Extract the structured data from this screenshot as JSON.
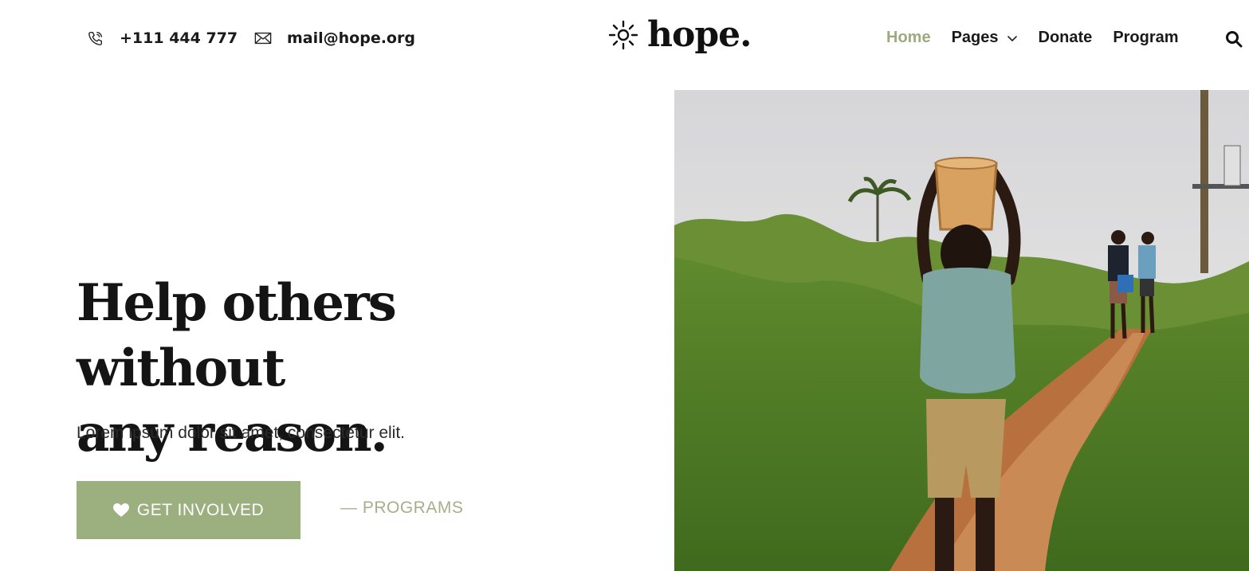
{
  "header": {
    "phone": "+111 444 777",
    "email": "mail@hope.org",
    "logo_text": "hope.",
    "icons": {
      "phone": "phone-icon",
      "mail": "mail-icon",
      "logo": "sun-icon",
      "search": "search-icon",
      "chevron": "chevron-down-icon"
    }
  },
  "nav": {
    "items": [
      {
        "label": "Home",
        "active": true
      },
      {
        "label": "Pages",
        "active": false,
        "has_dropdown": true
      },
      {
        "label": "Donate",
        "active": false
      },
      {
        "label": "Program",
        "active": false
      }
    ]
  },
  "hero": {
    "title_line1": "Help others without",
    "title_line2": "any reason.",
    "subtitle": "Lorem ipsum dolor sit amet, consectetur elit.",
    "primary_button": "GET INVOLVED",
    "secondary_link": "— PROGRAMS"
  },
  "colors": {
    "accent": "#9caf7f",
    "accent_text": "#9caa7f",
    "text": "#111111"
  }
}
